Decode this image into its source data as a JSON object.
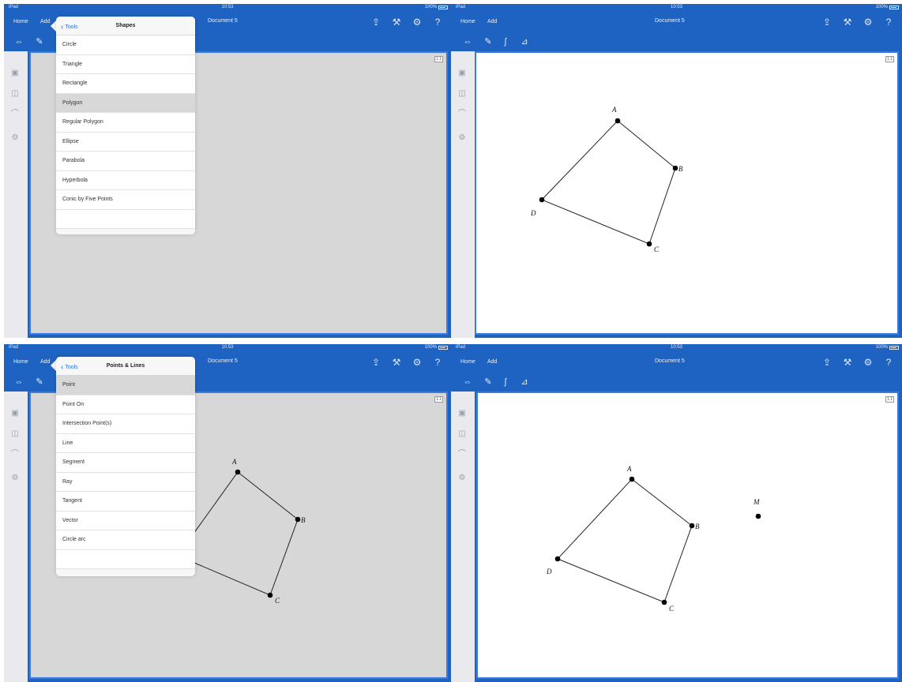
{
  "status": {
    "carrier": "iPad",
    "time": "10:53",
    "battery": "100%"
  },
  "nav": {
    "home": "Home",
    "add": "Add",
    "doc_title": "Document 5"
  },
  "page_tag": "1.1",
  "panels": {
    "shapes": {
      "back": "Tools",
      "title": "Shapes",
      "items": [
        "Circle",
        "Triangle",
        "Rectangle",
        "Polygon",
        "Regular Polygon",
        "Ellipse",
        "Parabola",
        "Hyperbola",
        "Conic by Five Points"
      ],
      "selected": "Polygon"
    },
    "points_lines": {
      "back": "Tools",
      "title": "Points & Lines",
      "items": [
        "Point",
        "Point On",
        "Intersection Point(s)",
        "Line",
        "Segment",
        "Ray",
        "Tangent",
        "Vector",
        "Circle arc"
      ],
      "selected": "Point"
    }
  },
  "vertex_labels": {
    "A": "A",
    "B": "B",
    "C": "C",
    "D": "D",
    "M": "M"
  },
  "icons": {
    "nav": [
      "share-icon",
      "tools-icon",
      "settings-icon",
      "help-icon"
    ],
    "toolbar": [
      "expand-icon",
      "wrench-icon",
      "math-icon",
      "graph-icon"
    ],
    "sidebar": [
      "page-sorter-icon",
      "book-icon",
      "scratchpad-icon",
      "settings-icon"
    ]
  }
}
